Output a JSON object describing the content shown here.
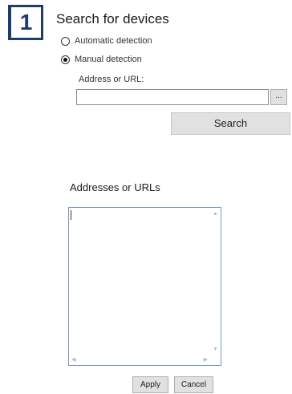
{
  "step": {
    "number": "1"
  },
  "search_section": {
    "title": "Search for devices",
    "options": [
      {
        "label": "Automatic detection",
        "selected": false
      },
      {
        "label": "Manual detection",
        "selected": true
      }
    ],
    "address_label": "Address or URL:",
    "address_value": "",
    "browse_label": "...",
    "search_button": "Search"
  },
  "list_section": {
    "label": "Addresses or URLs",
    "content": ""
  },
  "buttons": {
    "apply": "Apply",
    "cancel": "Cancel"
  },
  "icons": {
    "scroll_up": "caret-up-icon",
    "scroll_down": "caret-down-icon",
    "scroll_left": "caret-left-icon",
    "scroll_right": "caret-right-icon"
  },
  "colors": {
    "badge": "#1e3c6e",
    "list_border": "#7b96c6",
    "button_face": "#e1e1e1"
  }
}
